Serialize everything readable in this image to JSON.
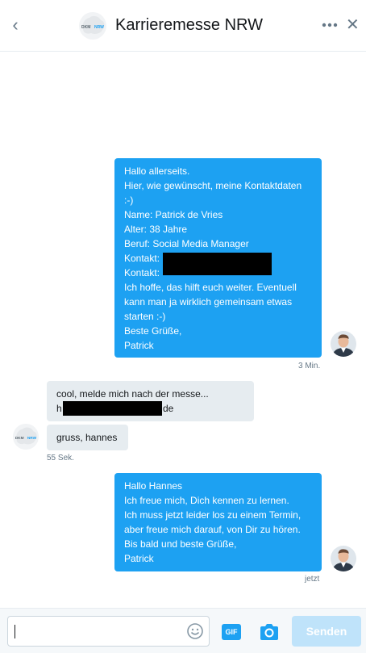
{
  "header": {
    "title": "Karrieremesse NRW",
    "back_icon": "chevron-left-icon",
    "more_icon": "more-dots-icon",
    "close_icon": "close-icon",
    "logo_text_left": "DKM",
    "logo_text_right": "NRW"
  },
  "messages": [
    {
      "direction": "out",
      "lines": [
        "Hallo allerseits.",
        "Hier, wie gewünscht, meine Kontaktdaten",
        ":-)",
        "Name: Patrick de Vries",
        "Alter: 38 Jahre",
        "Beruf: Social Media Manager",
        "Kontakt:",
        "Kontakt:",
        "Ich hoffe, das hilft euch weiter. Eventuell",
        "kann man ja wirklich gemeinsam etwas",
        "starten :-)",
        "Beste Grüße,",
        " Patrick"
      ],
      "time": "3 Min."
    },
    {
      "direction": "in",
      "lines": [
        "cool, melde mich nach der messe...",
        "h",
        "de"
      ]
    },
    {
      "direction": "in",
      "lines": [
        "gruss, hannes"
      ],
      "time": "55 Sek."
    },
    {
      "direction": "out",
      "lines": [
        "Hallo Hannes",
        "Ich freue mich, Dich kennen zu lernen.",
        "Ich muss jetzt leider los zu einem Termin,",
        "aber freue mich darauf, von Dir zu hören.",
        "Bis bald und beste Grüße,",
        " Patrick"
      ],
      "time": "jetzt"
    }
  ],
  "composer": {
    "input_value": "",
    "emoji_icon": "smiley-icon",
    "gif_label": "GIF",
    "camera_icon": "camera-icon",
    "send_label": "Senden"
  },
  "colors": {
    "accent": "#1da1f2",
    "incoming_bubble": "#e6ecf0",
    "send_disabled": "#bfe3fa",
    "muted_text": "#657786"
  }
}
